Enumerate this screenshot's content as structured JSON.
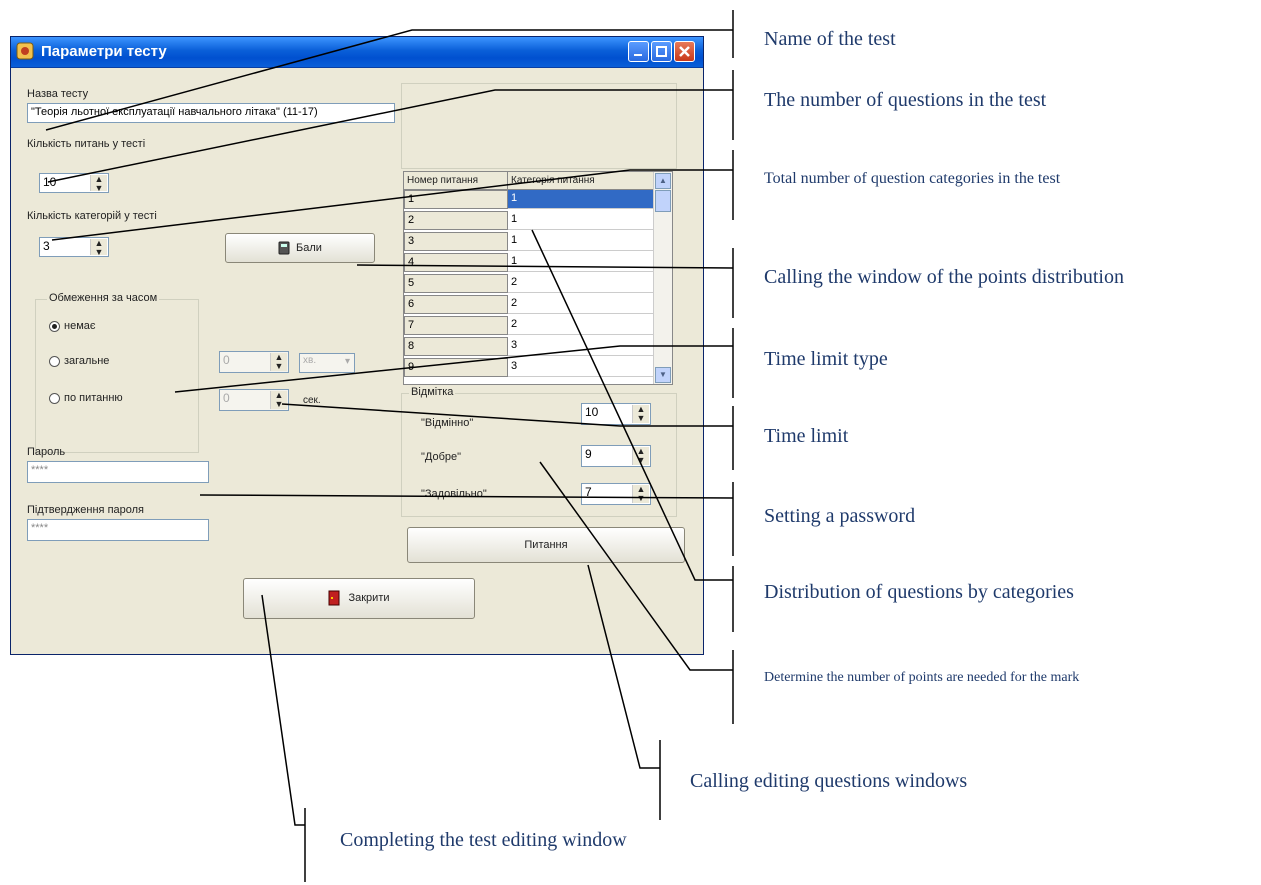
{
  "window": {
    "title": "Параметри тесту",
    "test_name_label": "Назва тесту",
    "test_name_value": "\"Теорія льотної експлуатації навчального літака\" (11-17)",
    "question_count_label": "Кількість питань у тесті",
    "question_count_value": "10",
    "category_count_label": "Кількість категорій у тесті",
    "category_count_value": "3",
    "points_button_label": "Бали",
    "time_group_label": "Обмеження за часом",
    "time_options": [
      "немає",
      "загальне",
      "по питанню"
    ],
    "time_total_value": "0",
    "time_total_unit": "хв.",
    "time_per_question_value": "0",
    "time_per_question_unit": "сек.",
    "password_label": "Пароль",
    "password_value": "****",
    "password_confirm_label": "Підтвердження пароля",
    "password_confirm_value": "****",
    "close_button_label": "Закрити",
    "grid_headers": [
      "Номер питання",
      "Категорія питання"
    ],
    "grid_rows": [
      {
        "num": "1",
        "cat": "1"
      },
      {
        "num": "2",
        "cat": "1"
      },
      {
        "num": "3",
        "cat": "1"
      },
      {
        "num": "4",
        "cat": "1"
      },
      {
        "num": "5",
        "cat": "2"
      },
      {
        "num": "6",
        "cat": "2"
      },
      {
        "num": "7",
        "cat": "2"
      },
      {
        "num": "8",
        "cat": "3"
      },
      {
        "num": "9",
        "cat": "3"
      }
    ],
    "mark_group_label": "Відмітка",
    "marks": [
      {
        "label": "\"Відмінно\"",
        "value": "10"
      },
      {
        "label": "\"Добре\"",
        "value": "9"
      },
      {
        "label": "\"Задовільно\"",
        "value": "7"
      }
    ],
    "questions_button_label": "Питання"
  },
  "annotations": {
    "name_of_test": "Name of the test",
    "number_of_questions": "The number of questions in the test",
    "total_categories": "Total number of question categories in the test",
    "points_window": "Calling the window of the points distribution",
    "time_limit_type": "Time limit type",
    "time_limit": "Time limit",
    "setting_password": "Setting a password",
    "distribution": "Distribution of questions by categories",
    "mark_points": "Determine the number of points are needed for the mark",
    "editing_questions": "Calling editing questions windows",
    "completing": "Completing the test editing window"
  },
  "colors": {
    "annotation_text": "#1f3a6b",
    "window_face": "#ece9d8",
    "title_bar": "#0a5fd8",
    "selection": "#316ac5"
  }
}
